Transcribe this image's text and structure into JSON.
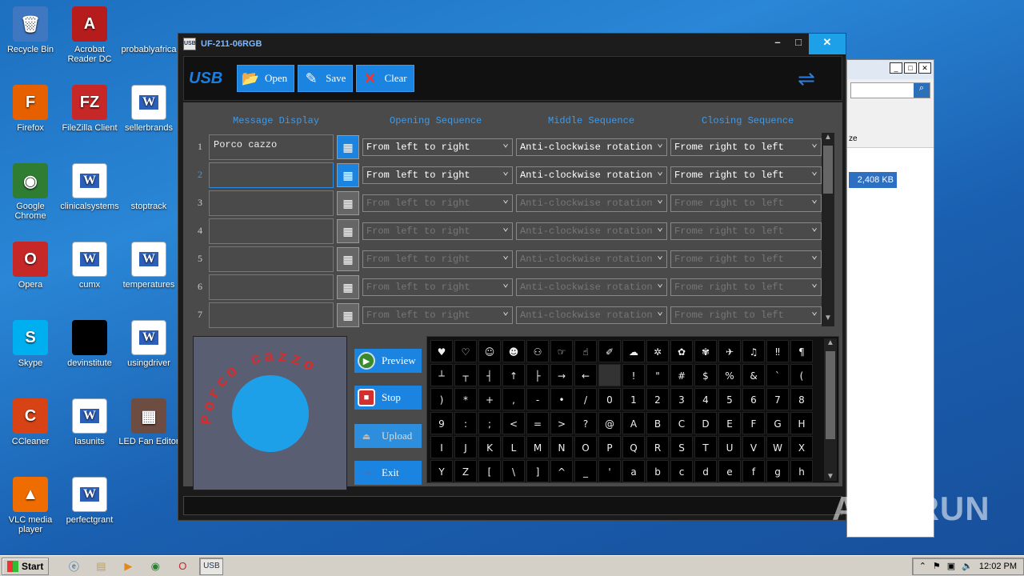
{
  "desktop": {
    "icons": [
      {
        "label": "Recycle Bin",
        "glyph": "🗑",
        "bg": "#3f78c0"
      },
      {
        "label": "Acrobat Reader DC",
        "glyph": "A",
        "bg": "#b71c1c"
      },
      {
        "label": "probablyafrica",
        "glyph": "",
        "bg": "transparent"
      },
      {
        "label": "Firefox",
        "glyph": "F",
        "bg": "#e66000"
      },
      {
        "label": "FileZilla Client",
        "glyph": "FZ",
        "bg": "#c62828"
      },
      {
        "label": "sellerbrands",
        "glyph": "W",
        "bg": "#fff"
      },
      {
        "label": "Google Chrome",
        "glyph": "◉",
        "bg": "#2e7d32"
      },
      {
        "label": "clinicalsystems",
        "glyph": "W",
        "bg": "#fff"
      },
      {
        "label": "stoptrack",
        "glyph": "",
        "bg": "transparent"
      },
      {
        "label": "Opera",
        "glyph": "O",
        "bg": "#c62828"
      },
      {
        "label": "cumx",
        "glyph": "W",
        "bg": "#fff"
      },
      {
        "label": "temperatures",
        "glyph": "W",
        "bg": "#fff"
      },
      {
        "label": "Skype",
        "glyph": "S",
        "bg": "#00aff0"
      },
      {
        "label": "devinstitute",
        "glyph": "",
        "bg": "#000"
      },
      {
        "label": "usingdriver",
        "glyph": "W",
        "bg": "#fff"
      },
      {
        "label": "CCleaner",
        "glyph": "C",
        "bg": "#d84315"
      },
      {
        "label": "lasunits",
        "glyph": "W",
        "bg": "#fff"
      },
      {
        "label": "LED Fan Editor",
        "glyph": "▦",
        "bg": "#6d4c41"
      },
      {
        "label": "VLC media player",
        "glyph": "▲",
        "bg": "#ef6c00"
      },
      {
        "label": "perfectgrant",
        "glyph": "W",
        "bg": "#fff"
      }
    ]
  },
  "bg_window": {
    "size_value": "2,408 KB",
    "header_text": "ze"
  },
  "app": {
    "title": "UF-211-06RGB",
    "toolbar": {
      "logo": "USB",
      "open": "Open",
      "save": "Save",
      "clear": "Clear"
    },
    "columns": {
      "message": "Message Display",
      "opening": "Opening Sequence",
      "middle": "Middle Sequence",
      "closing": "Closing Sequence"
    },
    "rows": [
      {
        "num": "1",
        "message": "Porco cazzo",
        "opening": "From left to right",
        "middle": "Anti-clockwise rotation",
        "closing": "Frome right to left"
      },
      {
        "num": "2",
        "message": "",
        "opening": "From left to right",
        "middle": "Anti-clockwise rotation",
        "closing": "Frome right to left"
      },
      {
        "num": "3",
        "message": "",
        "opening": "From left to right",
        "middle": "Anti-clockwise rotation",
        "closing": "Frome right to left"
      },
      {
        "num": "4",
        "message": "",
        "opening": "From left to right",
        "middle": "Anti-clockwise rotation",
        "closing": "Frome right to left"
      },
      {
        "num": "5",
        "message": "",
        "opening": "From left to right",
        "middle": "Anti-clockwise rotation",
        "closing": "Frome right to left"
      },
      {
        "num": "6",
        "message": "",
        "opening": "From left to right",
        "middle": "Anti-clockwise rotation",
        "closing": "Frome right to left"
      },
      {
        "num": "7",
        "message": "",
        "opening": "From left to right",
        "middle": "Anti-clockwise rotation",
        "closing": "Frome right to left"
      }
    ],
    "preview_text": "Porco cazzo",
    "actions": {
      "preview": "Preview",
      "stop": "Stop",
      "upload": "Upload",
      "exit": "Exit"
    },
    "chars": [
      "♥",
      "♡",
      "☺",
      "☻",
      "⚇",
      "☞",
      "☝",
      "✐",
      "☁",
      "✲",
      "✿",
      "✾",
      "✈",
      "♫",
      "‼",
      "¶",
      "┴",
      "┬",
      "┤",
      "↑",
      "├",
      "→",
      "←",
      "",
      "!",
      "\"",
      "#",
      "$",
      "%",
      "&",
      "`",
      "(",
      ")",
      "*",
      "+",
      ",",
      "-",
      "•",
      "/",
      "0",
      "1",
      "2",
      "3",
      "4",
      "5",
      "6",
      "7",
      "8",
      "9",
      ":",
      ";",
      "<",
      "=",
      ">",
      "?",
      "@",
      "A",
      "B",
      "C",
      "D",
      "E",
      "F",
      "G",
      "H",
      "I",
      "J",
      "K",
      "L",
      "M",
      "N",
      "O",
      "P",
      "Q",
      "R",
      "S",
      "T",
      "U",
      "V",
      "W",
      "X",
      "Y",
      "Z",
      "[",
      "\\",
      "]",
      "^",
      "_",
      "'",
      "a",
      "b",
      "c",
      "d",
      "e",
      "f",
      "g",
      "h"
    ]
  },
  "watermark": "ANY RUN",
  "taskbar": {
    "start": "Start",
    "clock": "12:02 PM"
  },
  "colors": {
    "accent": "#1a84e0",
    "preview_circle": "#1ea0e8",
    "preview_text": "#d32f2f"
  }
}
